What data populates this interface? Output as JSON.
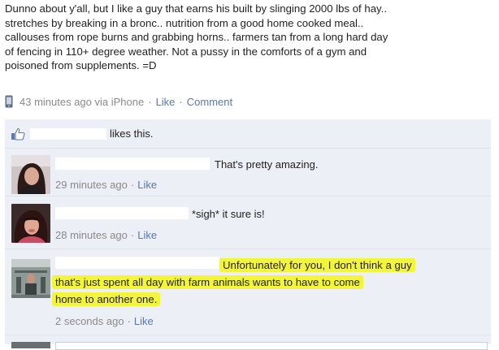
{
  "post": {
    "lines": [
      "Dunno about y'all, but I like a guy that earns his built by slinging 2000 lbs of hay..",
      "stretches by breaking in a bronc.. nutrition from a good home cooked meal..",
      "callouses from rope burns and grabbing horns.. farmers tan from a long hard day",
      "of fencing in 110+ degree weather. Not a pussy in the comforts of a gym and",
      "poisoned from supplements. =D"
    ],
    "time": "43 minutes ago via iPhone",
    "like_label": "Like",
    "comment_label": "Comment"
  },
  "likes": {
    "text": "likes this."
  },
  "comments": [
    {
      "text": "That's pretty amazing.",
      "time": "29 minutes ago",
      "like_label": "Like"
    },
    {
      "text": "*sigh* it sure is!",
      "time": "28 minutes ago",
      "like_label": "Like"
    },
    {
      "lines": [
        "Unfortunately for you, I don't think a guy",
        "that's just spent all day with farm animals wants to have to come",
        "home to another one."
      ],
      "time": "2 seconds ago",
      "like_label": "Like"
    }
  ],
  "colors": {
    "link": "#5a78b0",
    "highlight": "#f3f53a",
    "feedback_bg": "#eceff5"
  }
}
